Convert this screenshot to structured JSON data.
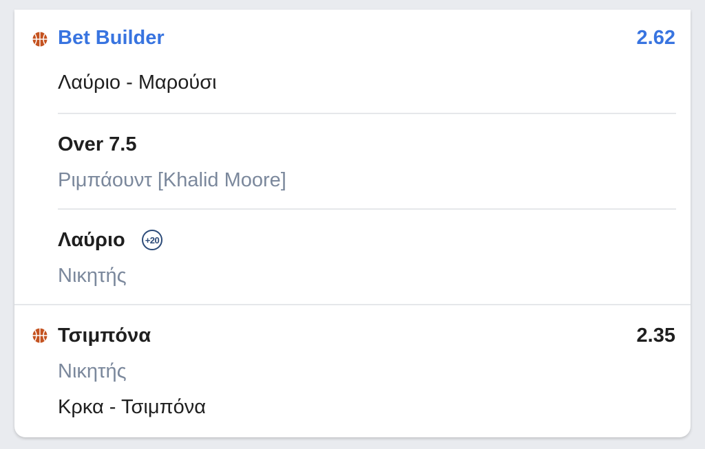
{
  "colors": {
    "accent": "#3874e0",
    "text_primary": "#1f1f1f",
    "text_secondary": "#7b889c",
    "basketball": "#c4521f",
    "badge": "#2b4a78"
  },
  "bet_builder": {
    "sport_icon": "basketball-icon",
    "title": "Bet Builder",
    "odds": "2.62",
    "match": "Λαύριο - Μαρούσι",
    "selections": [
      {
        "name": "Over 7.5",
        "market": "Ριμπάουντ [Khalid Moore]"
      },
      {
        "name": "Λαύριο",
        "badge": "+20",
        "market": "Νικητής"
      }
    ]
  },
  "single_bet": {
    "sport_icon": "basketball-icon",
    "selection": "Τσιμπόνα",
    "odds": "2.35",
    "market": "Νικητής",
    "match": "Κρκα - Τσιμπόνα"
  }
}
